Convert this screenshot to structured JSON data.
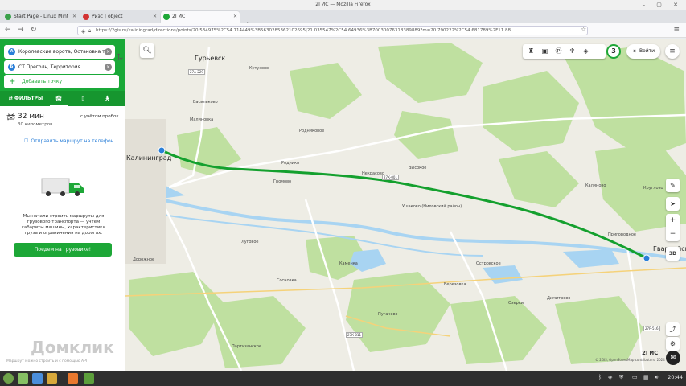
{
  "browser": {
    "window_title": "2ГИС — Mozilla Firefox",
    "tabs": [
      {
        "title": "Start Page - Linux Mint",
        "active": false,
        "favicon_color": "#3aa14b"
      },
      {
        "title": "Риэс | object",
        "active": false,
        "favicon_color": "#d33333"
      },
      {
        "title": "2ГИС",
        "active": true,
        "favicon_color": "#1da737"
      }
    ],
    "url": "https://2gis.ru/kaliningrad/directions/points/20.534975%2C54.714449%3B5630285362102695|21.035547%2C54.64936%3B70030076318389889?m=20.790222%2C54.681789%2F11.88"
  },
  "sidebar": {
    "from": {
      "letter": "A",
      "text": "Королевские ворота, Остановка т..."
    },
    "to": {
      "letter": "Б",
      "text": "СТ Прегoль, Территория"
    },
    "add_point": "Добавить точку",
    "modes": {
      "filters": "ФИЛЬТРЫ",
      "car_icon": "car-icon",
      "transit_icon": "bus-icon",
      "walk_icon": "walk-icon"
    },
    "summary": {
      "duration": "32 мин",
      "distance": "30 километров",
      "note": "с учётом пробок"
    },
    "send_to_phone": "Отправить маршрут на телефон",
    "truck_text": "Мы начали строить маршруты для грузового транспорта — учтём габариты машины, характеристики груза и ограничения на дорогах.",
    "truck_button": "Поедем на грузовике!",
    "footnote": "Маршрут можно строить и с помощью API"
  },
  "map": {
    "login": "Войти",
    "badge": "3",
    "mode_3d": "3D",
    "brand": "2ГИС",
    "copyright": "© 2GIS, OpenStreetMap contributors, 2024",
    "watermark": "Домклик",
    "labels": {
      "kaliningrad": "Калининград",
      "guryevsk": "Гурьевск",
      "gvardeysk": "Гвардейск",
      "vasilkovo": "Васильково",
      "malinovka": "Малиновка",
      "kutuzovo": "Кутузово",
      "ushakovo": "Ушаково (Ниловский район)",
      "rodniki": "Родники",
      "lugovoe": "Луговое",
      "gromovo": "Громово",
      "nekrasovo": "Некрасово",
      "vysokoe": "Высокое",
      "ozerki": "Озерки",
      "kamenka": "Каменка",
      "kalinkovo": "Калиново",
      "prigorodnoe": "Пригородное",
      "berezovka": "Березовка",
      "sosnovka": "Сосновка",
      "kruglovo": "Круглово",
      "rodnikovoe": "Родниковое",
      "dorozhnoe": "Дорожное",
      "partizanskoe": "Партизанское",
      "dimitrovo": "Димитрово",
      "ostrovskoe": "Островское",
      "pugachevo": "Пугачево"
    },
    "roads": {
      "a229": "27А-229",
      "r516": "27Р-516",
      "e28": "27К-001",
      "r11": "27К-011"
    },
    "colors": {
      "route": "#14a02e",
      "forest": "#bfe0a0",
      "water": "#a8d4f2",
      "background": "#eeede5"
    }
  },
  "taskbar": {
    "time": "20:44"
  }
}
